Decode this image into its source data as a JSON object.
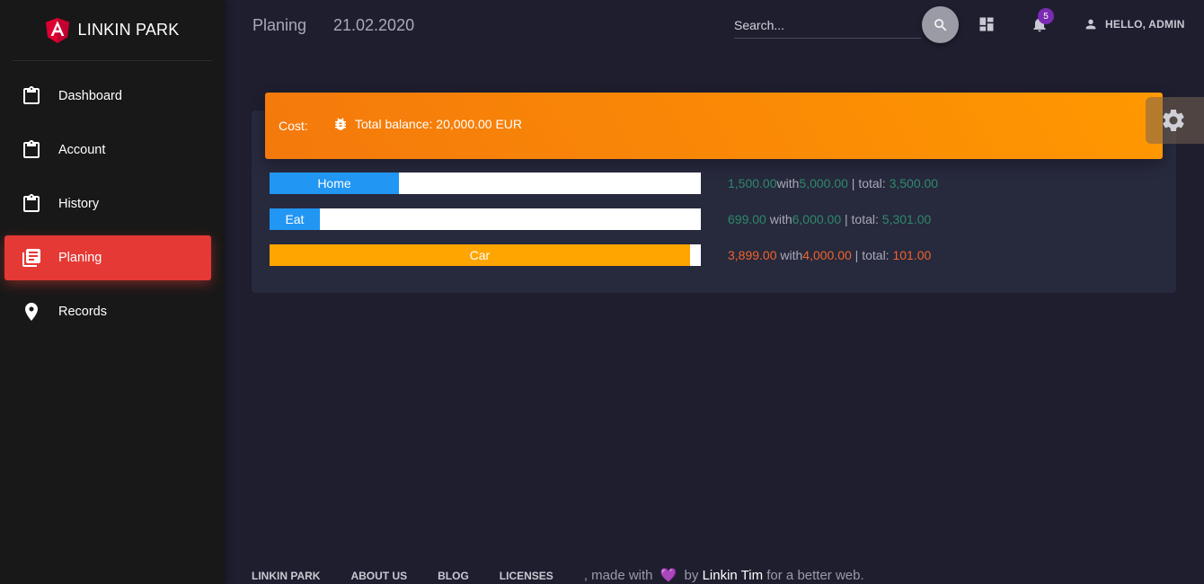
{
  "brand": {
    "name": "LINKIN PARK"
  },
  "sidebar": {
    "items": [
      {
        "label": "Dashboard",
        "icon": "clipboard-icon"
      },
      {
        "label": "Account",
        "icon": "clipboard-icon"
      },
      {
        "label": "History",
        "icon": "clipboard-icon"
      },
      {
        "label": "Planing",
        "icon": "library-books-icon",
        "active": true
      },
      {
        "label": "Records",
        "icon": "location-pin-icon"
      }
    ]
  },
  "header": {
    "title": "Planing",
    "date": "21.02.2020",
    "search_placeholder": "Search...",
    "notification_count": "5",
    "user_greeting": "HELLO, ADMIN"
  },
  "card": {
    "cost_label": "Cost:",
    "balance": "Total balance: 20,000.00 EUR",
    "rows": [
      {
        "label": "Home",
        "fill": 0.3,
        "color": "#2196f3",
        "spent": "1,500.00",
        "with_word": "with",
        "budget": "5,000.00",
        "total_label": " | total: ",
        "total": "3,500.00",
        "status": "ok"
      },
      {
        "label": "Eat",
        "fill": 0.1165,
        "color": "#2196f3",
        "spent": "699.00",
        "with_word": " with",
        "budget": "6,000.00",
        "total_label": " | total: ",
        "total": "5,301.00",
        "status": "ok"
      },
      {
        "label": "Car",
        "fill": 0.9748,
        "color": "#ffa500",
        "spent": "3,899.00",
        "with_word": " with",
        "budget": "4,000.00",
        "total_label": " | total: ",
        "total": "101.00",
        "status": "warn"
      }
    ]
  },
  "footer": {
    "links": [
      "LINKIN PARK",
      "ABOUT US",
      "BLOG",
      "LICENSES"
    ],
    "made_with": ", made with ",
    "by": " by ",
    "author": "Linkin Tim",
    "tail": " for a better web."
  },
  "colors": {
    "accent_red": "#e53935",
    "header_orange": "#ff9800",
    "bar_blue": "#2196f3",
    "bar_orange": "#ffa500",
    "value_green": "#2e8a6a",
    "value_red": "#f0642a",
    "badge_purple": "#7b2bb3"
  }
}
